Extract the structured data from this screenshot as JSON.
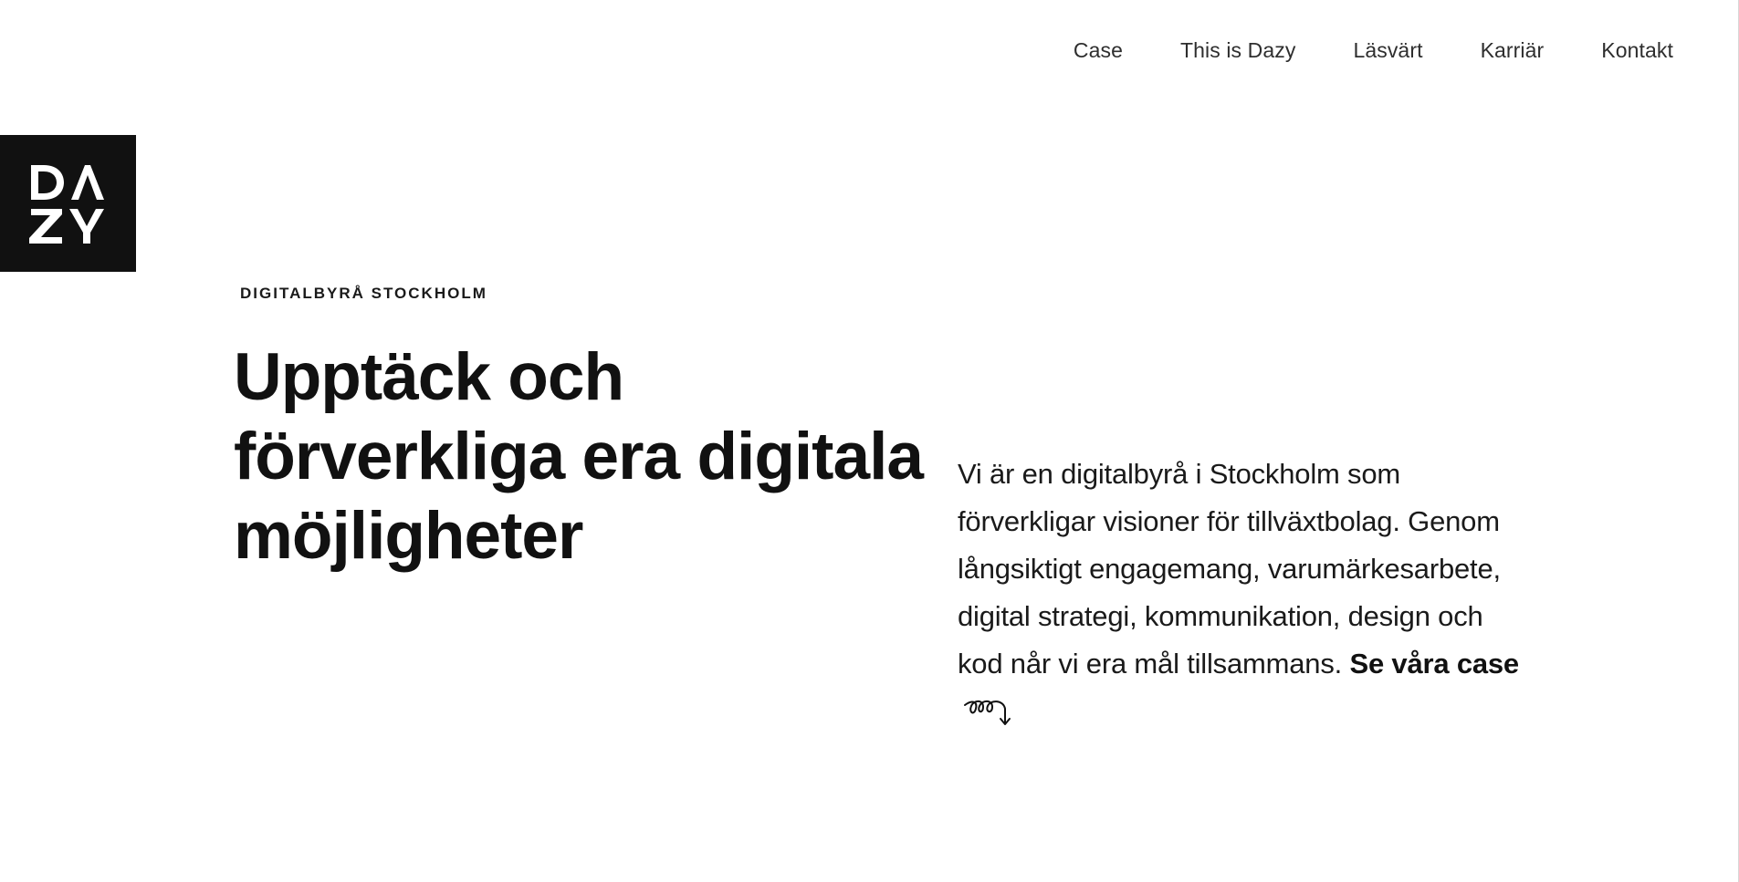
{
  "nav": {
    "items": [
      {
        "label": "Case"
      },
      {
        "label": "This is Dazy"
      },
      {
        "label": "Läsvärt"
      },
      {
        "label": "Karriär"
      },
      {
        "label": "Kontakt"
      }
    ]
  },
  "logo": {
    "text": "DAZY",
    "background": "#111111",
    "foreground": "#ffffff"
  },
  "hero": {
    "eyebrow": "DIGITALBYRÅ STOCKHOLM",
    "headline": "Upptäck och förverkliga era digitala möjligheter",
    "intro_text": "Vi är en digitalbyrå i Stockholm som förverkligar visioner för tillväxtbolag. Genom långsiktigt engagemang, varumärkesarbete, digital strategi, kommunikation, design och kod når vi era mål tillsammans.",
    "cta_label": "Se våra case",
    "cta_icon": "squiggle-arrow-down-icon"
  }
}
